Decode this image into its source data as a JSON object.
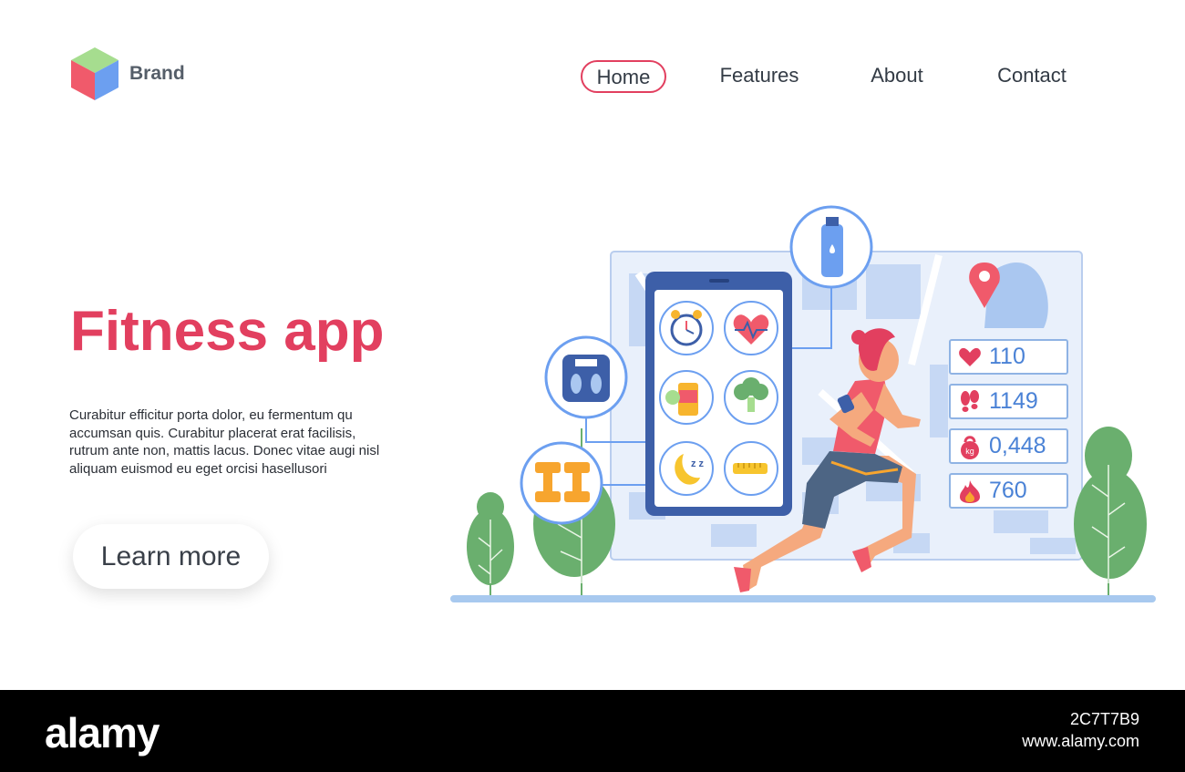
{
  "header": {
    "brand_name": "Brand",
    "nav": {
      "home": "Home",
      "features": "Features",
      "about": "About",
      "contact": "Contact"
    },
    "active_item": "Home"
  },
  "hero": {
    "title": "Fitness app",
    "text": "Curabitur efficitur porta dolor, eu fermentum qu accumsan quis. Curabitur placerat erat facilisis, rutrum ante non, mattis lacus. Donec vitae augi nisl aliquam euismod eu eget orcisi  hasellusori",
    "button_label": "Learn more"
  },
  "stats": [
    {
      "icon": "heart-icon",
      "value": "110"
    },
    {
      "icon": "footsteps-icon",
      "value": "1149"
    },
    {
      "icon": "kettlebell-icon",
      "value": "0,448"
    },
    {
      "icon": "flame-icon",
      "value": "760"
    }
  ],
  "illustration": {
    "kettlebell_label": "kg",
    "sleep_label": "z z",
    "app_icons": [
      "alarm-clock-icon",
      "heart-rate-icon",
      "pills-icon",
      "broccoli-icon",
      "sleep-moon-icon",
      "measuring-tape-icon"
    ],
    "callout_icons": [
      "water-bottle-icon",
      "bathroom-scale-icon",
      "dumbbells-icon"
    ]
  },
  "footer": {
    "logo": "alamy",
    "image_id": "2C7T7B9",
    "url": "www.alamy.com"
  },
  "colors": {
    "accent": "#e23f5f",
    "blue": "#4a82d6",
    "map_bg": "#e9f0fb",
    "green": "#6aaf6e"
  }
}
